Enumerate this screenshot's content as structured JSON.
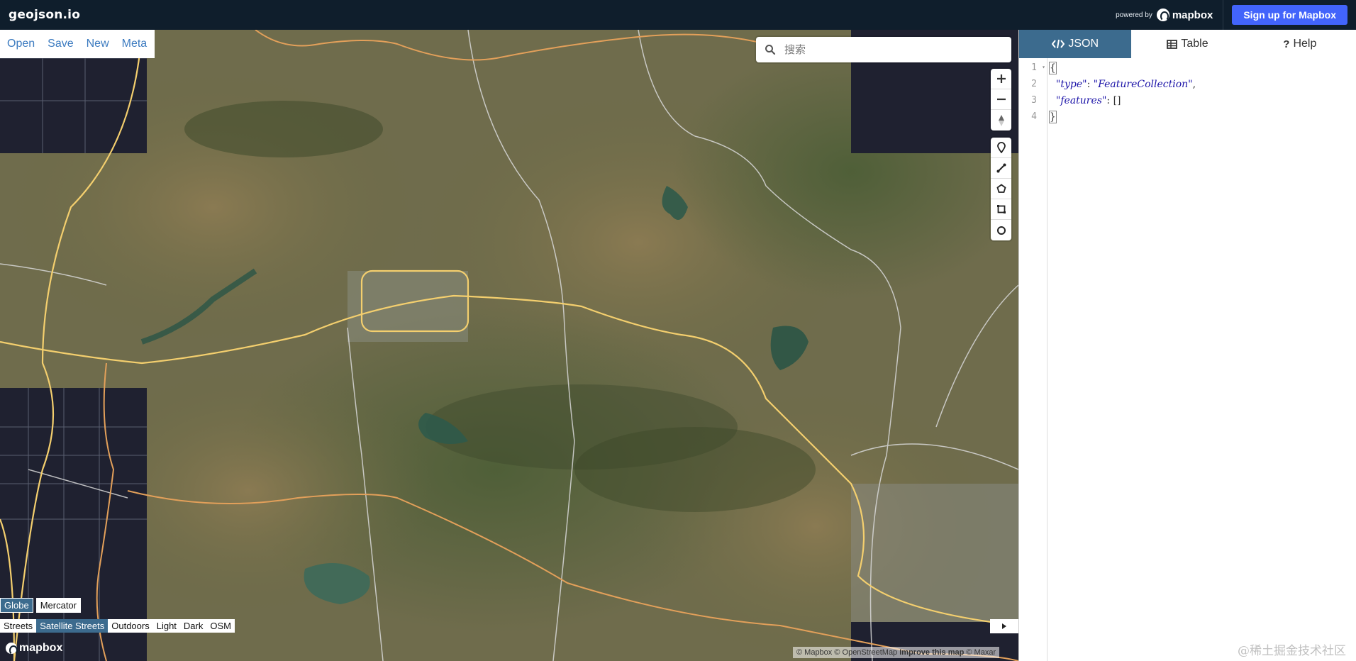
{
  "app": {
    "brand": "geojson.io",
    "powered_by": "powered by",
    "mapbox_wordmark": "mapbox",
    "signup_label": "Sign up for Mapbox"
  },
  "file_menu": {
    "open": "Open",
    "save": "Save",
    "new": "New",
    "meta": "Meta"
  },
  "search": {
    "placeholder": "搜索"
  },
  "map_controls": {
    "zoom_in": "+",
    "zoom_out": "−",
    "compass": "compass-icon",
    "draw_tools": [
      "marker-icon",
      "line-icon",
      "polygon-icon",
      "rectangle-icon",
      "circle-icon"
    ]
  },
  "projection": {
    "options": [
      "Globe",
      "Mercator"
    ],
    "active": "Globe"
  },
  "map_styles": {
    "options": [
      "Streets",
      "Satellite Streets",
      "Outdoors",
      "Light",
      "Dark",
      "OSM"
    ],
    "active": "Satellite Streets"
  },
  "attribution": {
    "mapbox": "© Mapbox",
    "osm": "© OpenStreetMap",
    "improve": "Improve this map",
    "maxar": "© Maxar"
  },
  "panel": {
    "tabs": [
      {
        "label": "JSON",
        "icon": "code-icon",
        "active": true
      },
      {
        "label": "Table",
        "icon": "table-icon",
        "active": false
      },
      {
        "label": "Help",
        "icon": "question-icon",
        "active": false
      }
    ],
    "lines": [
      {
        "no": "1",
        "text": "{"
      },
      {
        "no": "2",
        "key": "\"type\"",
        "value": "\"FeatureCollection\""
      },
      {
        "no": "3",
        "key": "\"features\"",
        "value": "[]"
      },
      {
        "no": "4",
        "text": "}"
      }
    ]
  },
  "watermark": "@稀土掘金技术社区",
  "colors": {
    "topbar": "#0f1e2c",
    "accent_blue": "#4264fb",
    "tab_active": "#3c6b8e",
    "link": "#3c7bc0"
  }
}
